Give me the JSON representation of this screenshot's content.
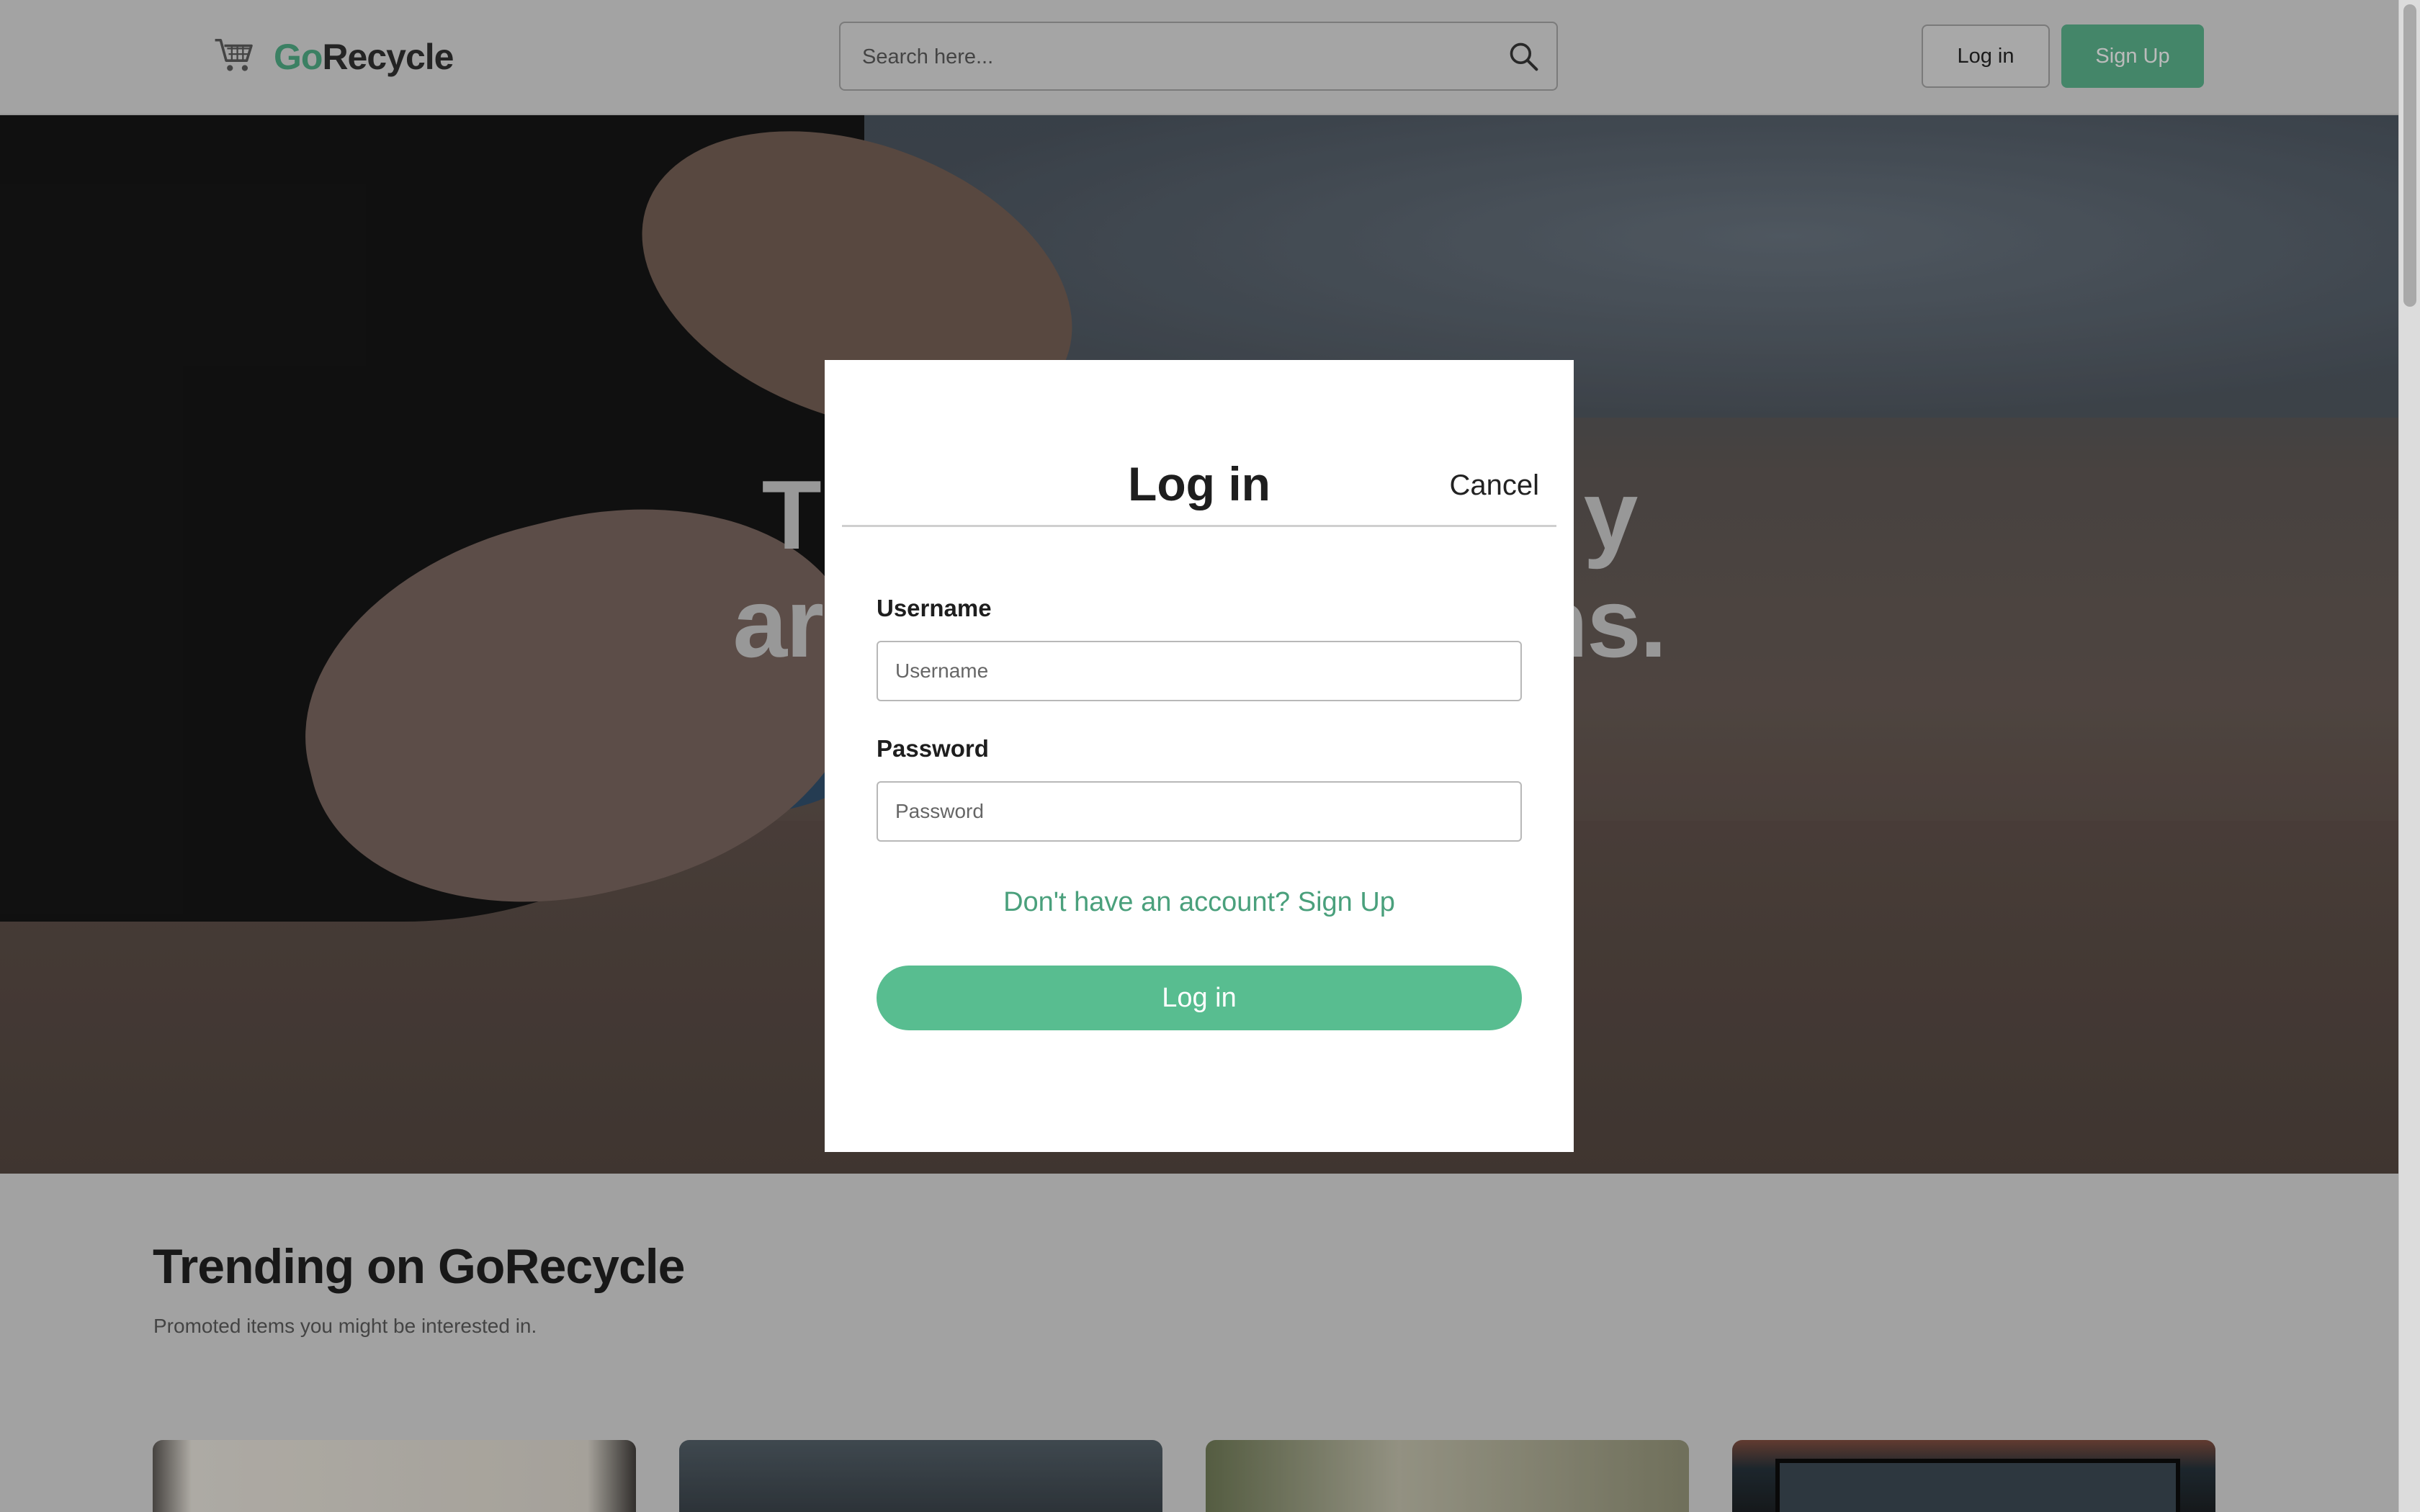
{
  "header": {
    "logo_go": "Go",
    "logo_rest": "Recycle",
    "search_placeholder": "Search here...",
    "login_label": "Log in",
    "signup_label": "Sign Up"
  },
  "hero": {
    "line1_left": "T",
    "line1_right": "y",
    "line2_left": "ar",
    "line2_right": "ns."
  },
  "modal": {
    "title": "Log in",
    "cancel_label": "Cancel",
    "username_label": "Username",
    "username_placeholder": "Username",
    "password_label": "Password",
    "password_placeholder": "Password",
    "signup_prompt": "Don't have an account? Sign Up",
    "submit_label": "Log in"
  },
  "trending": {
    "title": "Trending on GoRecycle",
    "subtitle": "Promoted items you might be interested in."
  },
  "colors": {
    "brand_green": "#4aa07c",
    "button_green": "#58bd90",
    "header_bg": "#cccccc"
  },
  "icons": {
    "logo": "shopping-cart-icon",
    "search": "magnifier-icon"
  }
}
